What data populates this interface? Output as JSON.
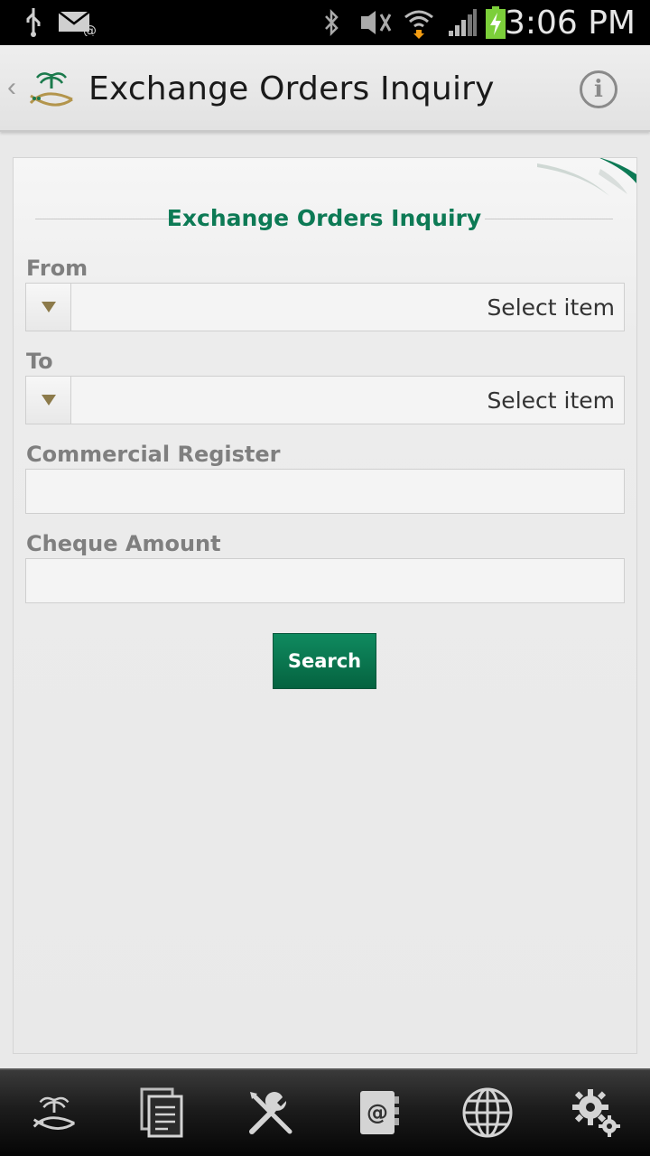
{
  "status_bar": {
    "time": "3:06 PM",
    "icons": [
      "usb-icon",
      "email-icon",
      "bluetooth-icon",
      "nfc-mute-icon",
      "wifi-icon",
      "signal-icon",
      "battery-charging-icon"
    ]
  },
  "action_bar": {
    "title": "Exchange Orders Inquiry",
    "back_glyph": "‹",
    "info_glyph": "i",
    "logo_icon": "ministry-logo-icon"
  },
  "form": {
    "heading": "Exchange Orders Inquiry",
    "from": {
      "label": "From",
      "value": "Select item"
    },
    "to": {
      "label": "To",
      "value": "Select item"
    },
    "commercial_register": {
      "label": "Commercial Register",
      "value": ""
    },
    "cheque_amount": {
      "label": "Cheque Amount",
      "value": ""
    },
    "search_label": "Search"
  },
  "bottom_nav": {
    "items": [
      "home-logo-icon",
      "documents-icon",
      "tools-icon",
      "contacts-icon",
      "globe-icon",
      "settings-icon"
    ]
  },
  "colors": {
    "accent": "#0d7a55",
    "arrow": "#8c7a4a"
  }
}
